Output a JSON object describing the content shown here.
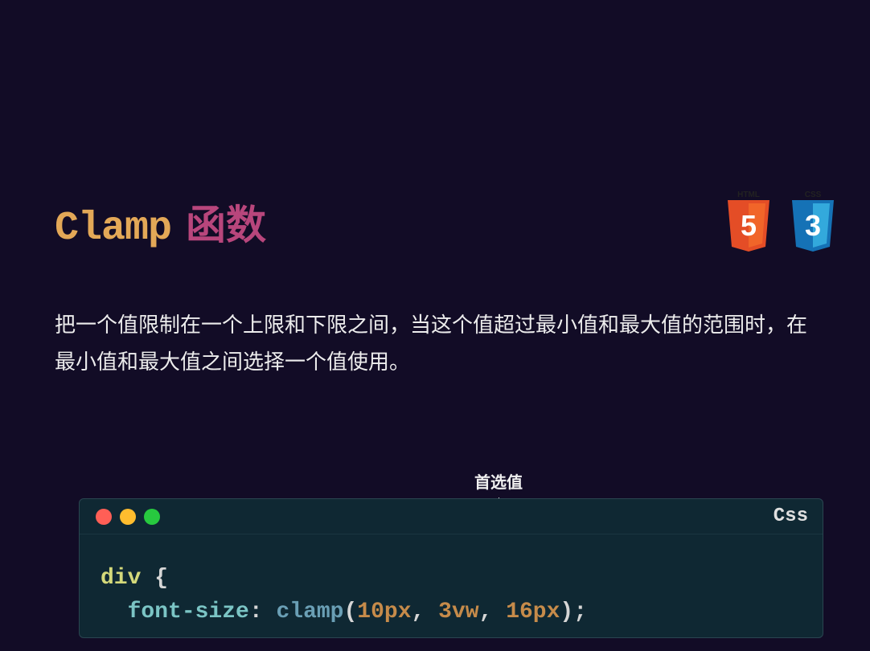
{
  "title": {
    "clamp": "Clamp",
    "rest": "函数"
  },
  "description": "把一个值限制在一个上限和下限之间，当这个值超过最小值和最大值的范围时，在最小值和最大值之间选择一个值使用。",
  "annotation": "首选值",
  "code": {
    "language": "Css",
    "selector": "div",
    "brace_open": "{",
    "property": "font-size",
    "colon": ":",
    "function": "clamp",
    "paren_open": "(",
    "value1": "10px",
    "comma1": ",",
    "value2": "3vw",
    "comma2": ",",
    "value3": "16px",
    "paren_close": ")",
    "semi": ";"
  },
  "logos": {
    "html5_label": "HTML",
    "html5_number": "5",
    "css3_label": "CSS",
    "css3_number": "3"
  }
}
